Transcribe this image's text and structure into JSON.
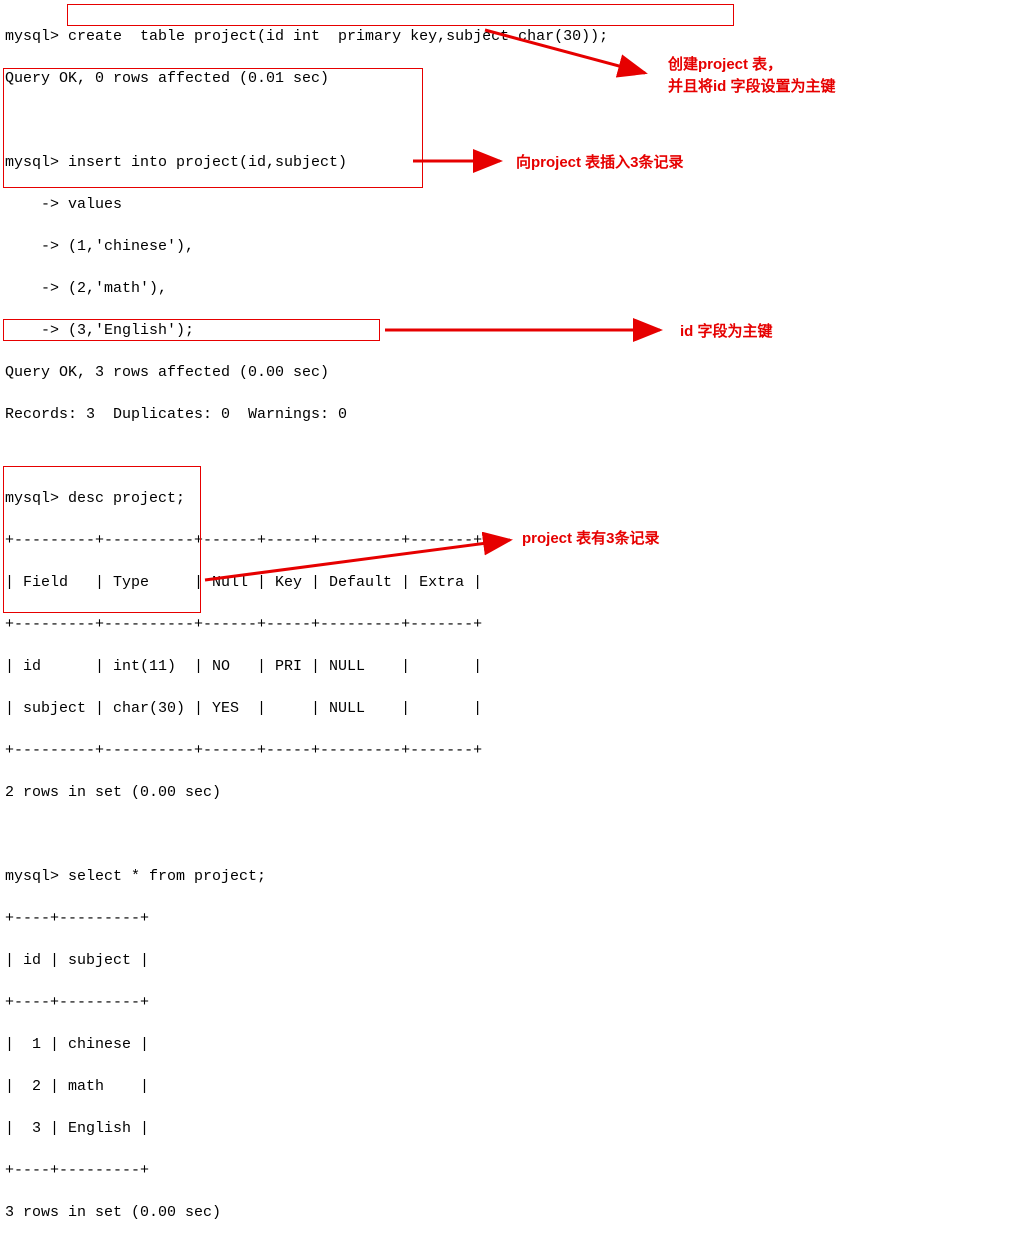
{
  "terminal": {
    "line1": "mysql> create  table project(id int  primary key,subject char(30));",
    "line2": "Query OK, 0 rows affected (0.01 sec)",
    "line3": "",
    "line4": "mysql> insert into project(id,subject)",
    "line5": "    -> values",
    "line6": "    -> (1,'chinese'),",
    "line7": "    -> (2,'math'),",
    "line8": "    -> (3,'English');",
    "line9": "Query OK, 3 rows affected (0.00 sec)",
    "line10": "Records: 3  Duplicates: 0  Warnings: 0",
    "line11": "",
    "line12": "mysql> desc project;",
    "line13": "+---------+----------+------+-----+---------+-------+",
    "line14": "| Field   | Type     | Null | Key | Default | Extra |",
    "line15": "+---------+----------+------+-----+---------+-------+",
    "line16": "| id      | int(11)  | NO   | PRI | NULL    |       |",
    "line17": "| subject | char(30) | YES  |     | NULL    |       |",
    "line18": "+---------+----------+------+-----+---------+-------+",
    "line19": "2 rows in set (0.00 sec)",
    "line20": "",
    "line21": "mysql> select * from project;",
    "line22": "+----+---------+",
    "line23": "| id | subject |",
    "line24": "+----+---------+",
    "line25": "|  1 | chinese |",
    "line26": "|  2 | math    |",
    "line27": "|  3 | English |",
    "line28": "+----+---------+",
    "line29": "3 rows in set (0.00 sec)"
  },
  "annotations": {
    "a1_line1": "创建project 表，",
    "a1_line2": "并且将id 字段设置为主键",
    "a2": "向project 表插入3条记录",
    "a3": "id 字段为主键",
    "a4": "project 表有3条记录"
  }
}
